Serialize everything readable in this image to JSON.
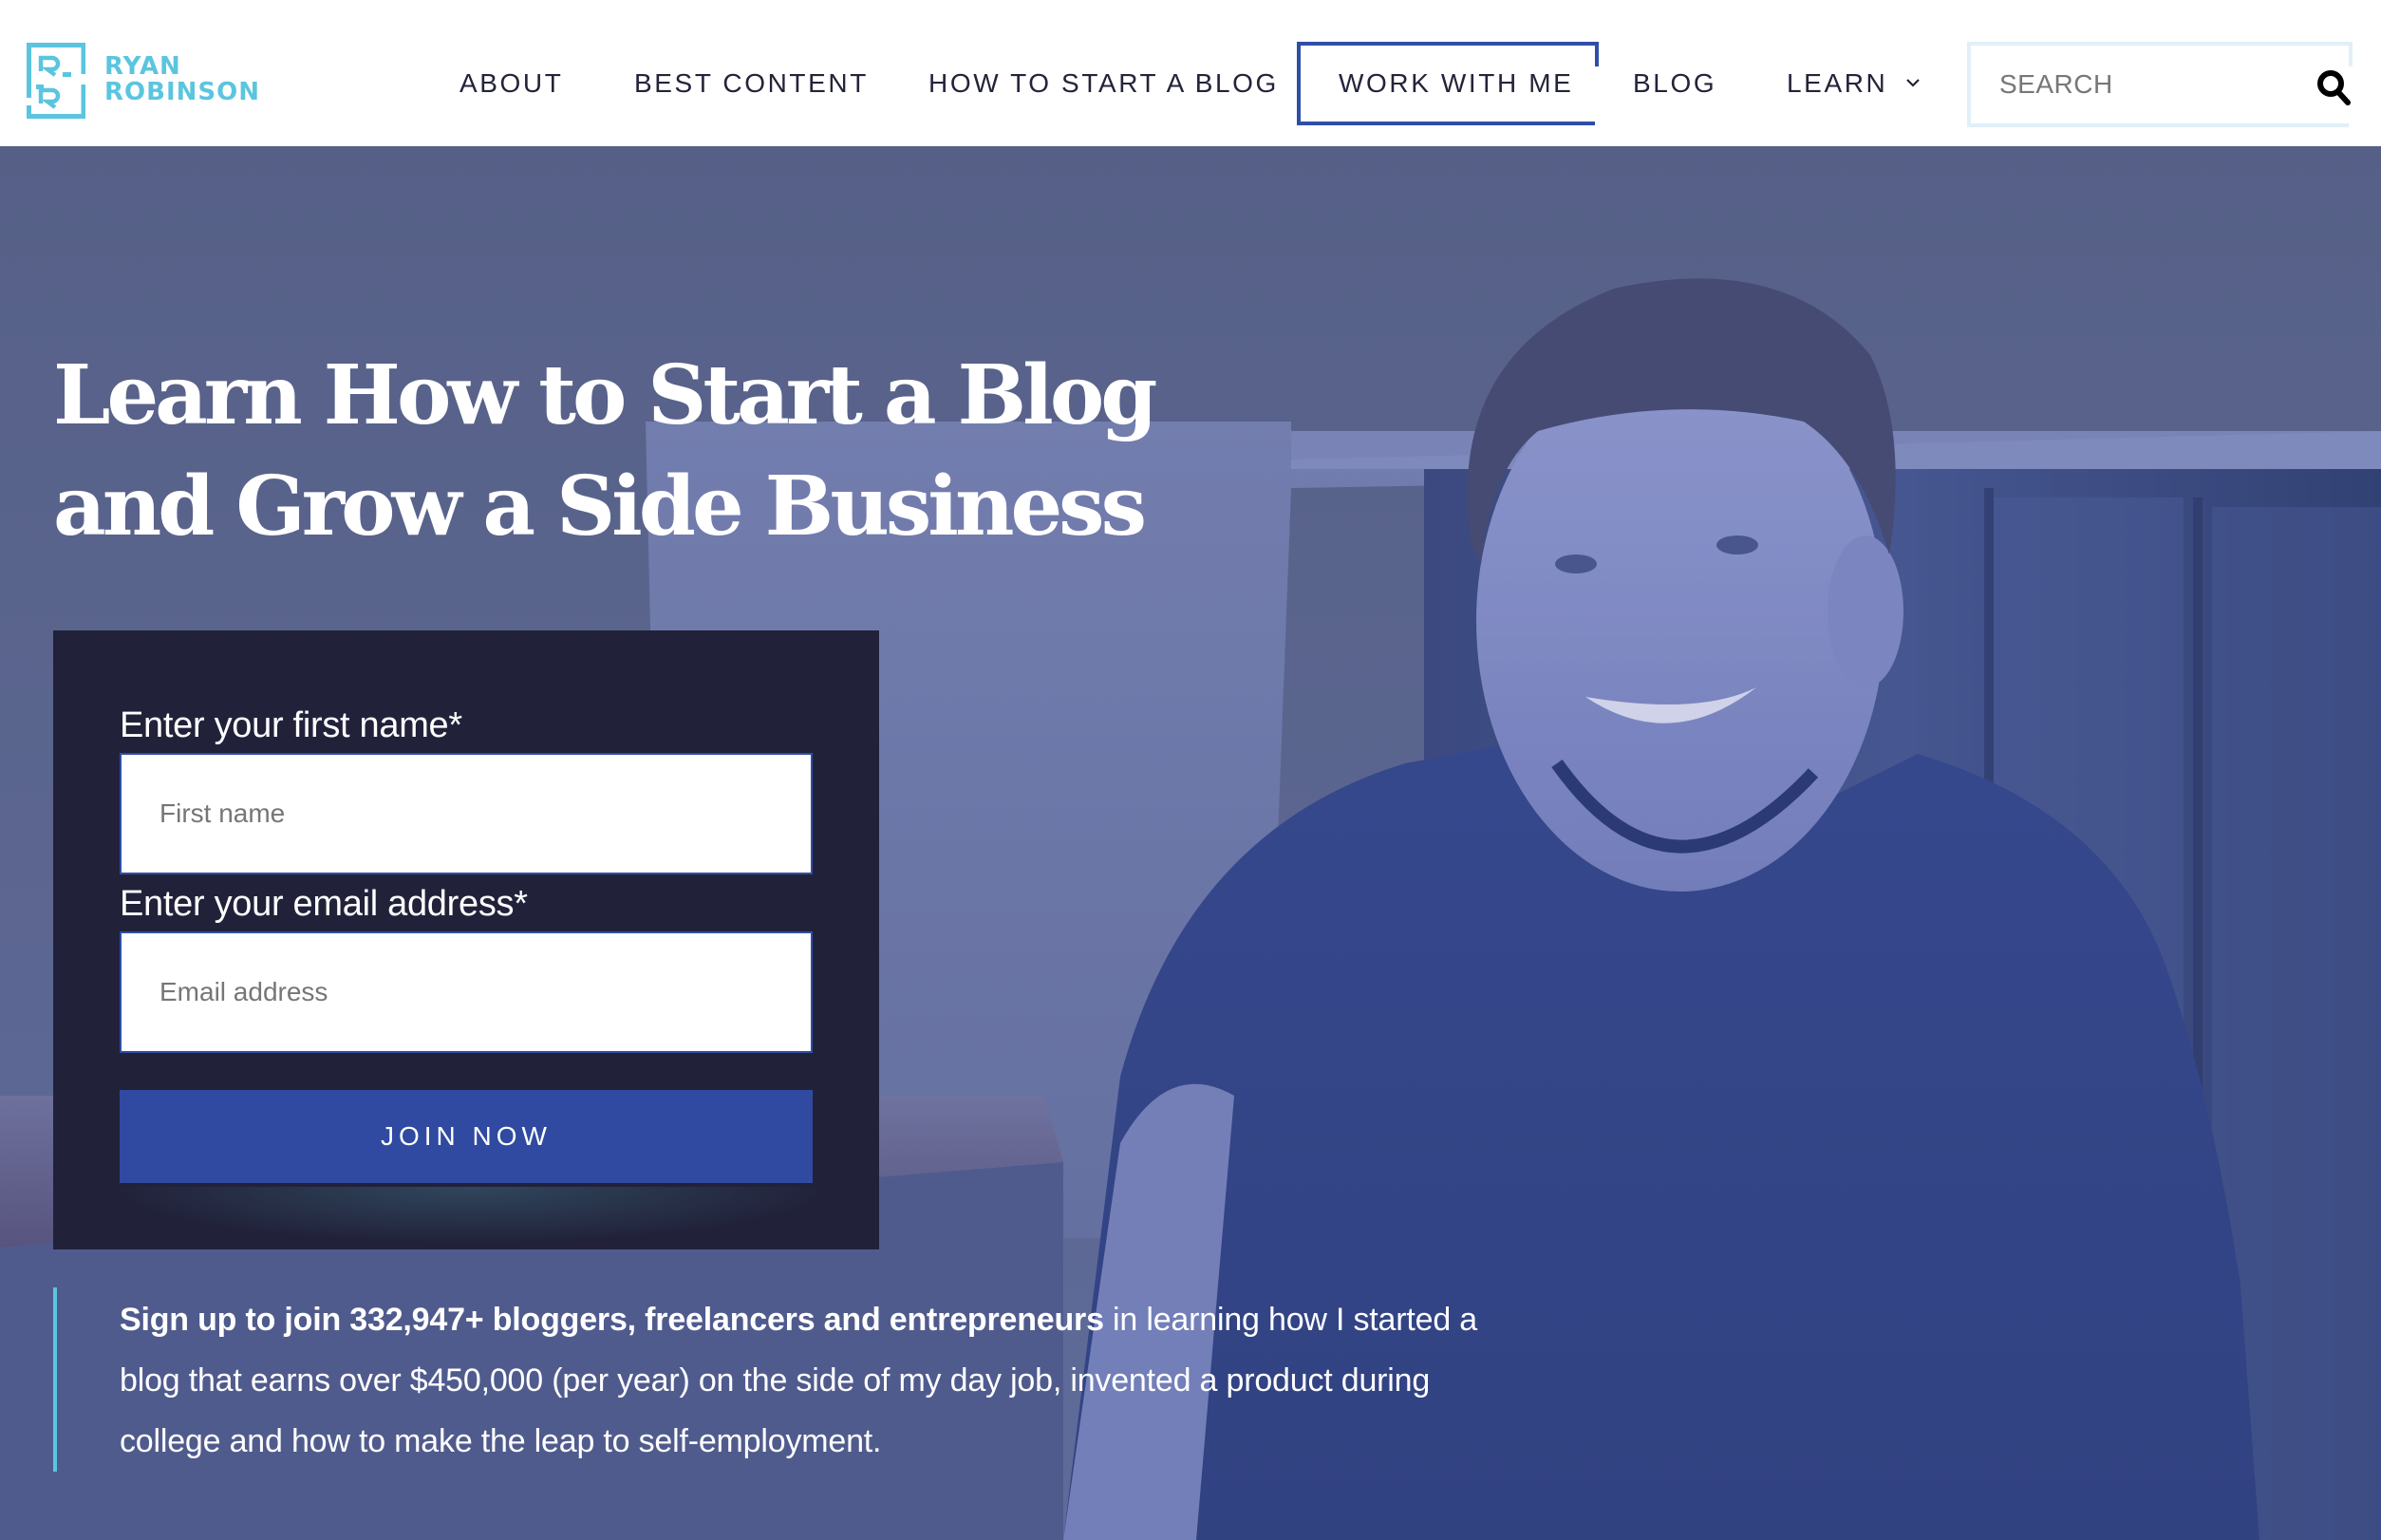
{
  "brand": {
    "line1": "RYAN",
    "line2": "ROBINSON",
    "color": "#5bc5df"
  },
  "nav": {
    "items": [
      {
        "label": "ABOUT"
      },
      {
        "label": "BEST CONTENT"
      },
      {
        "label": "HOW TO START A BLOG"
      },
      {
        "label": "WORK WITH ME",
        "highlighted": true
      },
      {
        "label": "BLOG"
      },
      {
        "label": "LEARN",
        "has_dropdown": true,
        "icon": "chevron-down-icon"
      }
    ],
    "search": {
      "placeholder": "SEARCH",
      "value": "",
      "icon": "search-icon"
    },
    "accent_color": "#2f4ea6"
  },
  "hero": {
    "title_line1": "Learn How to Start a Blog",
    "title_line2": "and Grow a Side Business",
    "form": {
      "first_name_label": "Enter your first name*",
      "first_name_placeholder": "First name",
      "first_name_value": "",
      "email_label": "Enter your email address*",
      "email_placeholder": "Email address",
      "email_value": "",
      "submit_label": "JOIN NOW",
      "button_color": "#2f4aa0",
      "panel_color": "#21223a"
    },
    "blurb": {
      "bold_text": "Sign up to join 332,947+ bloggers, freelancers and entrepreneurs",
      "regular_text": " in learning how I started a blog that earns over $450,000 (per year) on the side of my day job, invented a product during college and how to make the leap to self-employment.",
      "accent_color": "#5bc5df"
    },
    "image": {
      "description": "portrait-photo",
      "overlay_color": "#3a4fa8"
    }
  }
}
